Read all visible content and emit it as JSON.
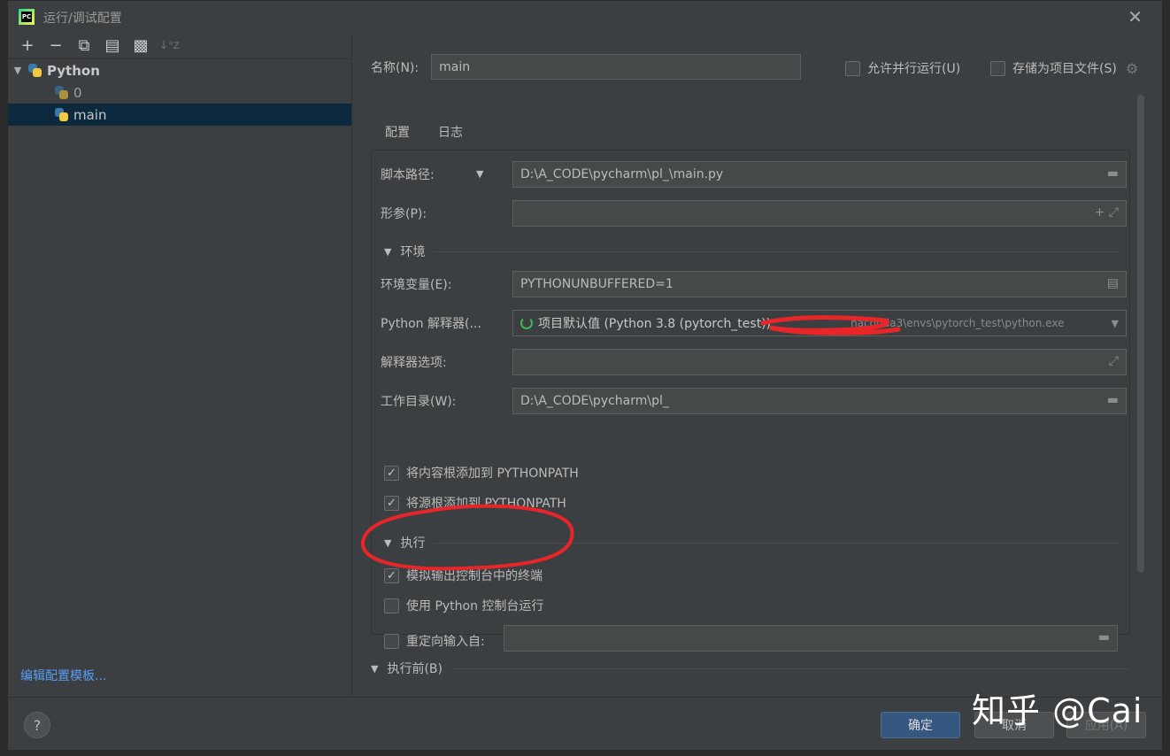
{
  "window": {
    "title": "运行/调试配置",
    "app_logo_text": "PC"
  },
  "toolbar": {
    "add": "+",
    "remove": "−",
    "copy": "⧉",
    "save": "▤",
    "folder": "▩",
    "sort": "↓ᵃz"
  },
  "tree": {
    "root_label": "Python",
    "items": [
      {
        "label": "0"
      },
      {
        "label": "main"
      }
    ]
  },
  "edit_templates": "编辑配置模板...",
  "name": {
    "label": "名称(N):",
    "value": "main"
  },
  "options": {
    "parallel": "允许并行运行(U)",
    "store_as_file": "存储为项目文件(S)"
  },
  "tabs": [
    {
      "label": "配置"
    },
    {
      "label": "日志"
    }
  ],
  "form": {
    "script_path_label": "脚本路径:",
    "script_path_value": "D:\\A_CODE\\pycharm\\pl_\\main.py",
    "params_label": "形参(P):",
    "env_section": "环境",
    "env_vars_label": "环境变量(E):",
    "env_vars_value": "PYTHONUNBUFFERED=1",
    "interpreter_label": "Python 解释器(...",
    "interpreter_value": "项目默认值 (Python 3.8 (pytorch_test))",
    "interpreter_path": "naconda3\\envs\\pytorch_test\\python.exe",
    "interp_options_label": "解释器选项:",
    "workdir_label": "工作目录(W):",
    "workdir_value": "D:\\A_CODE\\pycharm\\pl_",
    "add_content_roots": "将内容根添加到 PYTHONPATH",
    "add_source_roots": "将源根添加到 PYTHONPATH",
    "exec_section": "执行",
    "emulate_terminal": "模拟输出控制台中的终端",
    "use_python_console": "使用 Python 控制台运行",
    "redirect_input": "重定向输入自:"
  },
  "before_launch": "执行前(B)",
  "buttons": {
    "help": "?",
    "ok": "确定",
    "cancel": "取消",
    "apply": "应用(A)"
  },
  "watermark": "知乎 @Cai",
  "colors": {
    "accent": "#4a88c7",
    "primary_button": "#365880",
    "annotation": "#e8262a"
  }
}
